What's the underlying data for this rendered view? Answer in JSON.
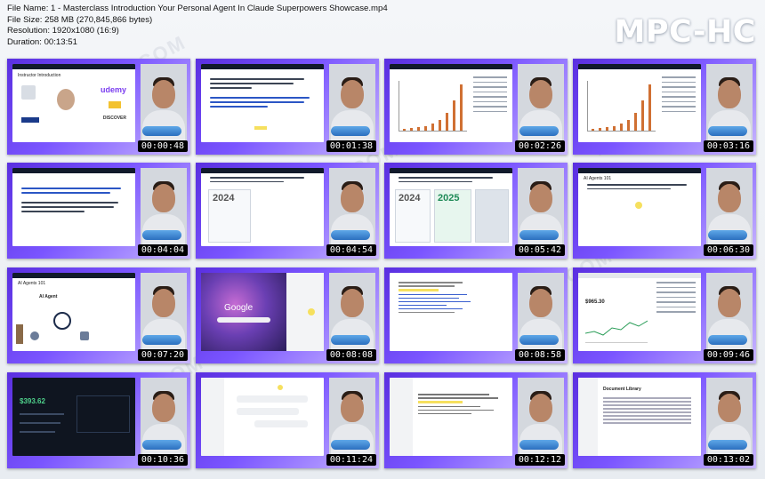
{
  "file_info": {
    "file_name": "File Name: 1 - Masterclass Introduction Your Personal Agent In Claude Superpowers Showcase.mp4",
    "file_size": "File Size: 258 MB (270,845,866 bytes)",
    "resolution": "Resolution: 1920x1080 (16:9)",
    "duration": "Duration: 00:13:51"
  },
  "logo": "MPC-HC",
  "colors": {
    "accent": "#6a3cf0",
    "timestamp_bg": "#000000",
    "bar_orange": "#d07033"
  },
  "thumbnails": [
    {
      "time": "00:00:48",
      "title": "Instructor Introduction",
      "brand1": "udemy",
      "brand2": "DISCOVER"
    },
    {
      "time": "00:01:38",
      "line1": "It's 7:47 AM. I pick up my phone and say: 'Hey Jarvis, what do I need to know today?'"
    },
    {
      "time": "00:02:26",
      "title": "AI Can Now Work a Full Shift",
      "cols": "What The Means"
    },
    {
      "time": "00:03:16",
      "title": "AI Can Now Work a Full Shift",
      "cols": "What The Means"
    },
    {
      "time": "00:04:04",
      "line1": "If it is that capable, what if you design a personal AI agent that actually knows you?"
    },
    {
      "time": "00:04:54",
      "title": "Work is Being Reinvented by Personal AI Agents",
      "year": "2024"
    },
    {
      "time": "00:05:42",
      "title": "Work is Being Reinvented by Personal AI Agents",
      "year1": "2024",
      "year2": "2025"
    },
    {
      "time": "00:06:30",
      "title": "AI Agents 101"
    },
    {
      "time": "00:07:20",
      "title": "AI Agents 101",
      "label": "AI Agent"
    },
    {
      "time": "00:08:08",
      "brand": "Google"
    },
    {
      "time": "00:08:58"
    },
    {
      "time": "00:09:46",
      "value": "$965.30"
    },
    {
      "time": "00:10:36",
      "value": "$393.62"
    },
    {
      "time": "00:11:24"
    },
    {
      "time": "00:12:12"
    },
    {
      "time": "00:13:02",
      "title": "Document Library"
    }
  ]
}
